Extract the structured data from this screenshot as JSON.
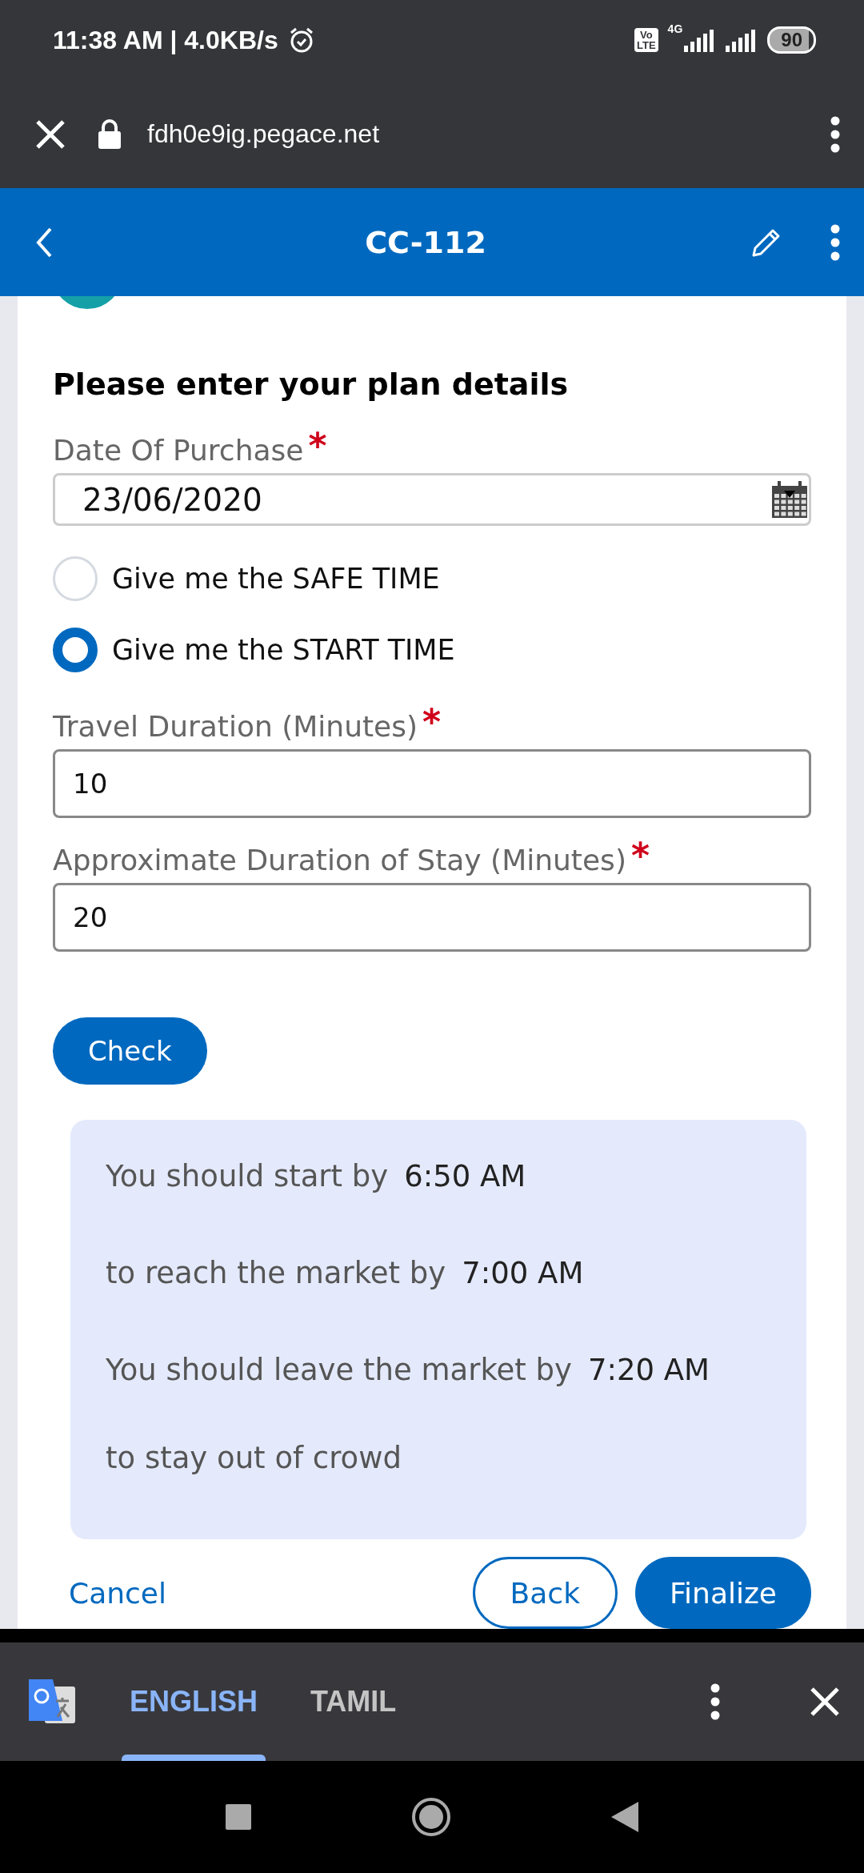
{
  "status_bar": {
    "time": "11:38 AM | 4.0KB/s",
    "volte": [
      "Vo",
      "LTE"
    ],
    "network": "4G",
    "battery": "90"
  },
  "browser": {
    "url": "fdh0e9ig.pegace.net"
  },
  "header": {
    "title": "CC-112"
  },
  "form": {
    "heading": "Please enter your plan details",
    "date_field": {
      "label": "Date Of Purchase",
      "required_mark": "*",
      "value": "23/06/2020"
    },
    "radios": [
      {
        "label": "Give me the SAFE TIME",
        "selected": false
      },
      {
        "label": "Give me the START TIME",
        "selected": true
      }
    ],
    "fields": [
      {
        "label": "Travel Duration (Minutes)",
        "required_mark": "*",
        "value": "10"
      },
      {
        "label": "Approximate Duration of Stay (Minutes)",
        "required_mark": "*",
        "value": "20"
      }
    ],
    "check_button": "Check",
    "result": [
      {
        "text": "You should start by",
        "time": "6:50 AM"
      },
      {
        "text": "to reach the market by",
        "time": "7:00 AM"
      },
      {
        "text": "You should leave the market by",
        "time": "7:20 AM"
      },
      {
        "text": "to stay out of crowd"
      }
    ],
    "actions": {
      "cancel": "Cancel",
      "back": "Back",
      "finalize": "Finalize"
    }
  },
  "translate_bar": {
    "languages": [
      {
        "label": "ENGLISH",
        "selected": true
      },
      {
        "label": "TAMIL",
        "selected": false
      }
    ]
  }
}
